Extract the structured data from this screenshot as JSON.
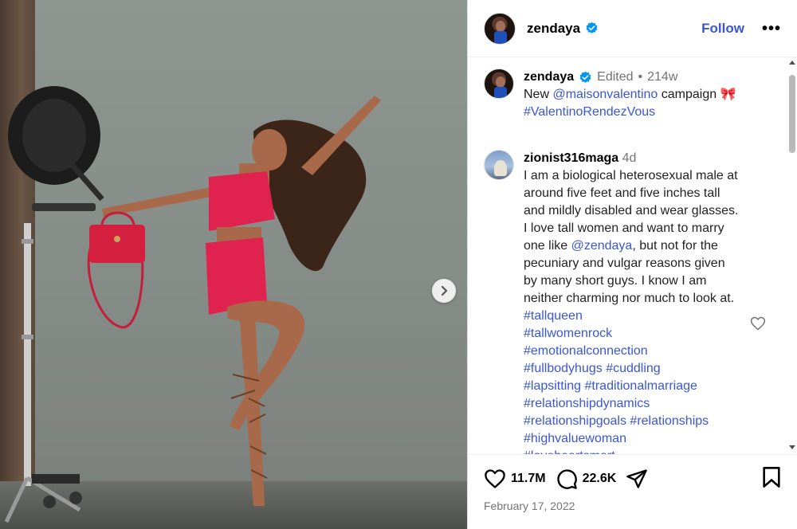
{
  "post": {
    "username": "zendaya",
    "follow_label": "Follow",
    "more_label": "•••"
  },
  "caption": {
    "username": "zendaya",
    "edited": "Edited",
    "dot": "•",
    "age": "214w",
    "text_before": "New ",
    "mention": "@maisonvalentino",
    "text_after": " campaign 🎀",
    "hashtag": "#ValentinoRendezVous"
  },
  "comment": {
    "username": "zionist316maga",
    "age": "4d",
    "text1": "I am a biological heterosexual male at around five feet and five inches tall and mildly disabled and wear glasses. I love tall women and want to marry one like ",
    "mention": "@zendaya",
    "text2": ", but not for the pecuniary and vulgar reasons given by many short guys. I know I am neither charming nor much to look at. ",
    "hashtags": [
      "#tallqueen",
      "#tallwomenrock",
      "#emotionalconnection",
      "#fullbodyhugs #cuddling",
      "#lapsitting #traditionalmarriage",
      "#relationshipdynamics",
      "#relationshipgoals #relationships",
      "#highvaluewoman",
      "#loveheartsmart"
    ]
  },
  "actions": {
    "likes": "11.7M",
    "comments": "22.6K"
  },
  "date": "February 17, 2022",
  "icons": {
    "verified": "verified-badge-icon",
    "like": "heart-icon",
    "comment": "comment-icon",
    "share": "share-icon",
    "save": "bookmark-icon",
    "next": "chevron-right-icon"
  },
  "colors": {
    "accent": "#3a56d4",
    "verified": "#0095f6",
    "muted": "#737373",
    "dress": "#e0234e"
  }
}
